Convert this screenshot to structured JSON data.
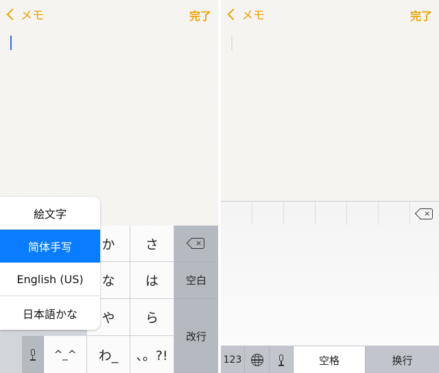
{
  "accent_color": "#e9a300",
  "selection_color": "#0a7cff",
  "left_screen": {
    "nav": {
      "back_label": "メモ",
      "done_label": "完了"
    },
    "keyboard_switcher": {
      "items": [
        {
          "label": "絵文字"
        },
        {
          "label": "简体手写",
          "selected": true
        },
        {
          "label": "English (US)"
        },
        {
          "label": "日本語かな"
        }
      ]
    },
    "keyboard": {
      "row1": [
        "か",
        "さ"
      ],
      "row2": [
        "な",
        "は"
      ],
      "row3": [
        "や",
        "ら"
      ],
      "row4": [
        "^_^",
        "わ_",
        "、。?!"
      ],
      "space_label": "空白",
      "return_label": "改行",
      "icons": [
        "mic-icon",
        "backspace-icon"
      ]
    }
  },
  "right_screen": {
    "nav": {
      "back_label": "メモ",
      "done_label": "完了"
    },
    "bottom_bar": {
      "numbers_label": "123",
      "space_label": "空格",
      "return_label": "换行",
      "icons": [
        "globe-icon",
        "mic-icon",
        "backspace-icon"
      ]
    }
  }
}
